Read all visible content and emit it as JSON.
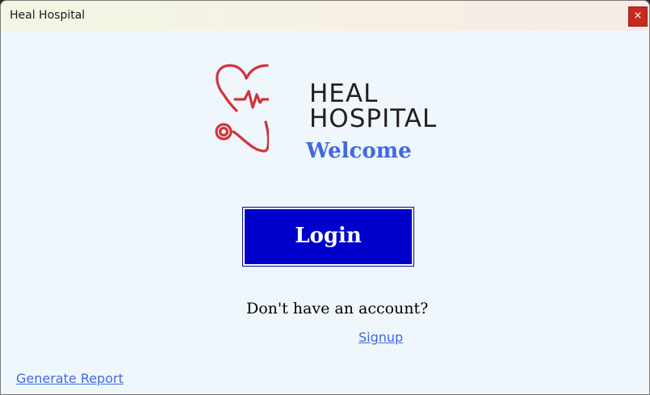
{
  "window": {
    "title": "Heal Hospital",
    "close_glyph": "×"
  },
  "logo": {
    "icon": "heart-stethoscope-icon",
    "line1": "HEAL",
    "line2": "HOSPITAL",
    "color": "#d13438"
  },
  "main": {
    "welcome": "Welcome",
    "login_label": "Login",
    "no_account_text": "Don't have an account?",
    "signup_label": "Signup",
    "report_label": "Generate Report"
  },
  "colors": {
    "accent": "#4169e1",
    "login_bg": "#0000cd",
    "close_bg": "#c42b1c",
    "window_bg": "#eff7fd"
  }
}
